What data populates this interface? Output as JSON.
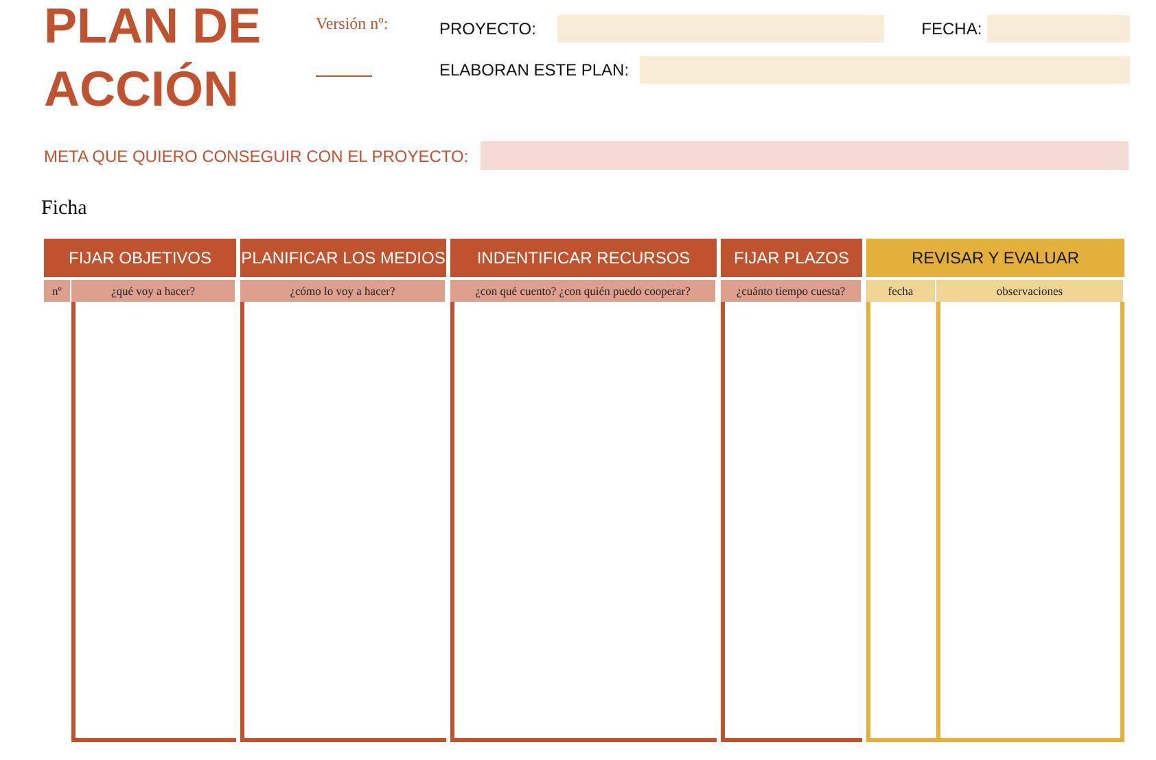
{
  "title": "PLAN DE ACCIÓN",
  "version": {
    "label": "Versión nº:"
  },
  "fields": [
    {
      "label": "PROYECTO:"
    },
    {
      "label": "FECHA:"
    },
    {
      "label": "ELABORAN ESTE PLAN:"
    }
  ],
  "goal": {
    "label": "META QUE QUIERO CONSEGUIR CON EL PROYECTO:"
  },
  "sheet_label": "Ficha",
  "sections": [
    {
      "title": "FIJAR OBJETIVOS",
      "color": "#c0532f",
      "columns": [
        "nº",
        "¿qué voy a hacer?"
      ]
    },
    {
      "title": "PLANIFICAR LOS MEDIOS",
      "color": "#c0532f",
      "columns": [
        "¿cómo lo voy a hacer?"
      ]
    },
    {
      "title": "INDENTIFICAR RECURSOS",
      "color": "#c0532f",
      "columns": [
        "¿con qué cuento? ¿con quién puedo cooperar?"
      ]
    },
    {
      "title": "FIJAR PLAZOS",
      "color": "#c0532f",
      "columns": [
        "¿cuánto tiempo cuesta?"
      ]
    },
    {
      "title": "REVISAR Y EVALUAR",
      "color": "#e3b13b",
      "columns": [
        "fecha",
        "observaciones"
      ]
    }
  ]
}
